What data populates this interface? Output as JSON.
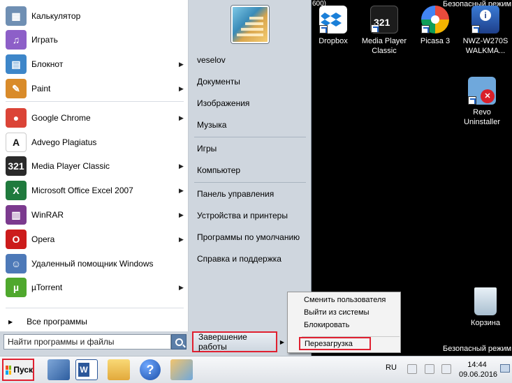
{
  "desktop": {
    "top_text": "600)",
    "safe_mode_top": "Безопасный режим",
    "safe_mode_bottom": "Безопасный режим",
    "icons": [
      {
        "label_line1": "Dropbox",
        "label_line2": "",
        "icon": "dropbox-icon"
      },
      {
        "label_line1": "Media Player",
        "label_line2": "Classic",
        "icon": "media-player-classic-icon"
      },
      {
        "label_line1": "Picasa 3",
        "label_line2": "",
        "icon": "picasa-icon"
      },
      {
        "label_line1": "NWZ-W270S",
        "label_line2": "WALKMA...",
        "icon": "walkman-icon"
      },
      {
        "label_line1": "Revo",
        "label_line2": "Uninstaller",
        "icon": "revo-uninstaller-icon"
      },
      {
        "label_line1": "Корзина",
        "label_line2": "",
        "icon": "recycle-bin-icon"
      }
    ]
  },
  "start_menu": {
    "programs": [
      {
        "label": "Калькулятор",
        "icon": "calculator-icon",
        "color": "#6f8fb3",
        "glyph": "▦",
        "submenu": false
      },
      {
        "label": "Играть",
        "icon": "play-icon",
        "color": "#8d5fc8",
        "glyph": "♫",
        "submenu": false
      },
      {
        "label": "Блокнот",
        "icon": "notepad-icon",
        "color": "#3d86c9",
        "glyph": "▤",
        "submenu": true
      },
      {
        "label": "Paint",
        "icon": "paint-icon",
        "color": "#d98b2a",
        "glyph": "✎",
        "submenu": true
      },
      {
        "label": "Google Chrome",
        "icon": "chrome-icon",
        "color": "#db4437",
        "glyph": "●",
        "submenu": true
      },
      {
        "label": "Advego Plagiatus",
        "icon": "advego-icon",
        "color": "#ffffff",
        "glyph": "A",
        "submenu": false
      },
      {
        "label": "Media Player Classic",
        "icon": "media-player-classic-icon",
        "color": "#2a2a2a",
        "glyph": "321",
        "submenu": true
      },
      {
        "label": "Microsoft Office Excel 2007",
        "icon": "excel-icon",
        "color": "#1f7a3d",
        "glyph": "X",
        "submenu": true
      },
      {
        "label": "WinRAR",
        "icon": "winrar-icon",
        "color": "#7b3a8e",
        "glyph": "▥",
        "submenu": true
      },
      {
        "label": "Opera",
        "icon": "opera-icon",
        "color": "#cc1b1b",
        "glyph": "O",
        "submenu": true
      },
      {
        "label": "Удаленный помощник Windows",
        "icon": "remote-assistance-icon",
        "color": "#4d79b8",
        "glyph": "☺",
        "submenu": false
      },
      {
        "label": "µTorrent",
        "icon": "utorrent-icon",
        "color": "#4fa82d",
        "glyph": "µ",
        "submenu": true
      }
    ],
    "all_programs": "Все программы",
    "search_placeholder": "Найти программы и файлы",
    "right": {
      "username": "veselov",
      "items_group1": [
        "Документы",
        "Изображения",
        "Музыка"
      ],
      "items_group2": [
        "Игры",
        "Компьютер"
      ],
      "items_group3": [
        "Панель управления",
        "Устройства и принтеры",
        "Программы по умолчанию",
        "Справка и поддержка"
      ]
    },
    "shutdown_label": "Завершение работы",
    "shutdown_submenu": [
      "Сменить пользователя",
      "Выйти из системы",
      "Блокировать",
      "Перезагрузка"
    ]
  },
  "taskbar": {
    "start_label": "Пуск",
    "pinned": [
      "remote-assistance-icon",
      "word-icon",
      "explorer-folder-icon",
      "help-icon",
      "paint-icon"
    ],
    "language": "RU",
    "time": "14:44",
    "date": "09.06.2016"
  },
  "colors": {
    "highlight_red": "#e02030",
    "menu_left_bg": "#ffffff",
    "menu_right_bg": "#cfd6de"
  }
}
